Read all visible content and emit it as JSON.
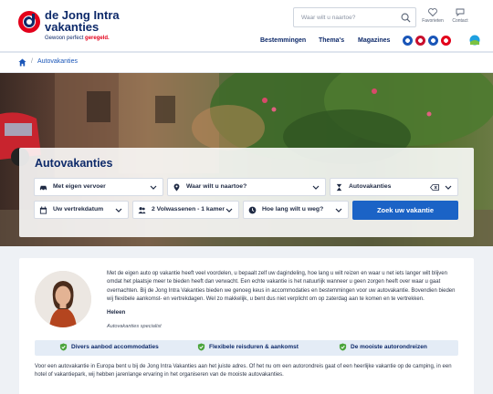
{
  "header": {
    "logo_line1": "de Jong Intra",
    "logo_line2": "vakanties",
    "tagline_prefix": "Gewoon perfect ",
    "tagline_bold": "geregeld.",
    "search_placeholder": "Waar wilt u naartoe?",
    "favorites_label": "Favorieten",
    "contact_label": "Contact",
    "nav": [
      "Bestemmingen",
      "Thema's",
      "Magazines"
    ],
    "brand_blue": "#0e2a6a",
    "brand_red": "#e3001b"
  },
  "breadcrumb": {
    "separator": "/",
    "current": "Autovakanties"
  },
  "hero": {
    "title": "Autovakanties",
    "fields": {
      "transport": "Met eigen vervoer",
      "destination": "Waar wilt u naartoe?",
      "theme": "Autovakanties",
      "date": "Uw vertrekdatum",
      "travelers": "2 Volwassenen - 1 kamer",
      "duration": "Hoe lang wilt u weg?"
    },
    "search_button": "Zoek uw vakantie"
  },
  "content": {
    "intro": "Met de eigen auto op vakantie heeft veel voordelen, u bepaalt zelf uw dagindeling, hoe lang u wilt reizen en waar u net iets langer wilt blijven omdat het plaatsje meer te bieden heeft dan verwacht. Een echte vakantie is het natuurlijk wanneer u geen zorgen heeft over waar u gaat overnachten. Bij de Jong Intra Vakanties bieden we genoeg keus in accommodaties en bestemmingen voor uw autovakantie. Bovendien bieden wij flexibele aankomst- en vertrekdagen. Wel zo makkelijk, u bent dus niet verplicht om op zaterdag aan te komen en te vertrekken.",
    "author": "Heleen",
    "author_role": "Autovakanties specialist",
    "usps": [
      "Divers aanbod accommodaties",
      "Flexibele reisduren & aankomst",
      "De mooiste autorondreizen"
    ],
    "paragraph": "Voor een autovakantie in Europa bent u bij de Jong Intra Vakanties aan het juiste adres. Of het nu om een autorondreis gaat of een heerlijke vakantie op de camping, in een hotel of vakantiepark, wij hebben jarenlange ervaring in het organiseren van de mooiste autovakanties."
  }
}
